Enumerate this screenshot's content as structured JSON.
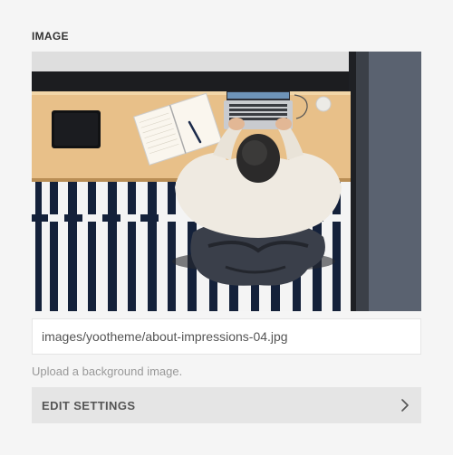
{
  "section": {
    "title": "IMAGE"
  },
  "image": {
    "alt": "Person working at a laptop on a wooden desk, seen from above",
    "path": "images/yootheme/about-impressions-04.jpg"
  },
  "help_text": "Upload a background image.",
  "edit_settings": {
    "label": "EDIT SETTINGS",
    "icon": "chevron-right-icon"
  },
  "colors": {
    "background": "#f5f5f5",
    "field_background": "#ffffff",
    "button_background": "#e5e5e5",
    "desk": "#e8c089",
    "rug_dark": "#14213a"
  }
}
